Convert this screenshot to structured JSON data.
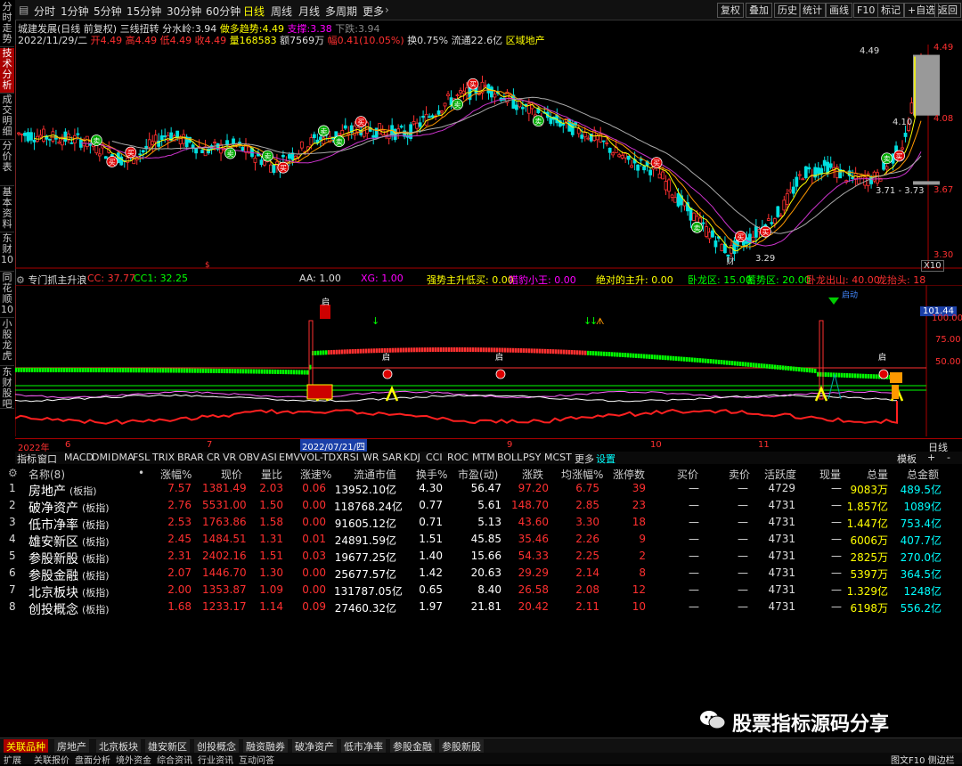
{
  "left_tabs": [
    {
      "label": "分时走势",
      "active": false
    },
    {
      "label": "技术分析",
      "active": true
    },
    {
      "label": "成交明细",
      "active": false
    },
    {
      "label": "分价表",
      "active": false
    },
    {
      "label": "基本资料",
      "active": false
    },
    {
      "label": "东财10",
      "active": false
    },
    {
      "label": "同花顺10",
      "active": false
    },
    {
      "label": "小股龙虎",
      "active": false
    },
    {
      "label": "东财股吧",
      "active": false
    }
  ],
  "periods": [
    "分时",
    "1分钟",
    "5分钟",
    "15分钟",
    "30分钟",
    "60分钟",
    "日线",
    "周线",
    "月线",
    "多周期",
    "更多"
  ],
  "active_period": "日线",
  "top_right_buttons": [
    "复权",
    "叠加",
    "历史",
    "统计",
    "画线",
    "F10",
    "标记",
    "+自选",
    "返回"
  ],
  "stock": {
    "title": "城建发展(日线 前复权)",
    "indicator": "三线扭转",
    "fenshuiling_label": "分水岭:",
    "fenshuiling": "3.94",
    "zuoduo_label": "做多趋势:",
    "zuoduo": "4.49",
    "zhicheng_label": "支撑:",
    "zhicheng": "3.38",
    "xiadie_label": "下跌:",
    "xiadie": "3.94",
    "date": "2022/11/29/二",
    "open_label": "开",
    "open": "4.49",
    "high_label": "高",
    "high": "4.49",
    "low_label": "低",
    "low": "4.49",
    "close_label": "收",
    "close": "4.49",
    "vol_label": "量",
    "vol": "168583",
    "amount_label": "额",
    "amount": "7569万",
    "change_label": "幅",
    "change": "0.41(10.05%)",
    "turnover_label": "换",
    "turnover": "0.75%",
    "float_label": "流通",
    "float": "22.6亿",
    "sector": "区域地产"
  },
  "price_axis": [
    "4.49",
    "4.08",
    "3.67",
    "3.30"
  ],
  "price_annotations": {
    "high": "4.49",
    "mid": "4.10",
    "range": "3.71 - 3.73",
    "low": "3.29",
    "x_label": "X10"
  },
  "lower_panel": {
    "title": "专门抓主升浪",
    "items": [
      {
        "label": "CC: 37.77",
        "color": "#ff3030"
      },
      {
        "label": "CC1: 32.25",
        "color": "#0f0"
      },
      {
        "label": "AA: 1.00",
        "color": "#ddd"
      },
      {
        "label": "XG: 1.00",
        "color": "#f0f"
      },
      {
        "label": "强势主升低买: 0.00",
        "color": "#ff0"
      },
      {
        "label": "猎豹小王: 0.00",
        "color": "#f0f"
      },
      {
        "label": "绝对的主升: 0.00",
        "color": "#ff0"
      },
      {
        "label": "卧龙区: 15.00",
        "color": "#0f0"
      },
      {
        "label": "蓄势区: 20.00",
        "color": "#0f0"
      },
      {
        "label": "卧龙出山: 40.00",
        "color": "#ff3030"
      },
      {
        "label": "龙抬头: 18",
        "color": "#ff3030"
      }
    ],
    "axis": [
      "101.44",
      "100.00",
      "75.00",
      "50.00"
    ],
    "marks": {
      "start": "启",
      "buy": "买入",
      "sell": "卖出",
      "qi_dong": "启动"
    }
  },
  "date_axis": {
    "labels": [
      "2022年",
      "6",
      "7",
      "2022/07/21/四",
      "9",
      "10",
      "11"
    ],
    "period": "日线"
  },
  "indicator_tabs": [
    "指标",
    "窗口",
    "MACD",
    "DMI",
    "DMA",
    "FSL",
    "TRIX",
    "BRAR",
    "CR",
    "VR",
    "OBV",
    "ASI",
    "EMV",
    "VOL-TDX",
    "RSI",
    "WR",
    "SAR",
    "KDJ",
    "CCI",
    "ROC",
    "MTM",
    "BOLL",
    "PSY",
    "MCST",
    "更多",
    "设置"
  ],
  "indicator_right": [
    "模板",
    "+",
    "-"
  ],
  "table": {
    "headers": [
      "名称(8)",
      "•",
      "涨幅%",
      "现价",
      "量比",
      "涨速%",
      "流通市值",
      "换手%",
      "市盈(动)",
      "涨跌",
      "均涨幅%",
      "涨停数",
      "买价",
      "卖价",
      "活跃度",
      "现量",
      "总量",
      "总金额"
    ],
    "rows": [
      {
        "idx": "1",
        "name": "房地产",
        "tag": "(板指)",
        "chg": "7.57",
        "price": "1381.49",
        "lb": "2.03",
        "speed": "0.06",
        "mv": "13952.10亿",
        "turn": "4.30",
        "pe": "56.47",
        "diff": "97.20",
        "avg": "6.75",
        "zt": "39",
        "buy": "—",
        "sell": "—",
        "act": "4729",
        "cur": "—",
        "vol": "9083万",
        "amt": "489.5亿"
      },
      {
        "idx": "2",
        "name": "破净资产",
        "tag": "(板指)",
        "chg": "2.76",
        "price": "5531.00",
        "lb": "1.50",
        "speed": "0.00",
        "mv": "118768.24亿",
        "turn": "0.77",
        "pe": "5.61",
        "diff": "148.70",
        "avg": "2.85",
        "zt": "23",
        "buy": "—",
        "sell": "—",
        "act": "4731",
        "cur": "—",
        "vol": "1.857亿",
        "amt": "1089亿"
      },
      {
        "idx": "3",
        "name": "低市净率",
        "tag": "(板指)",
        "chg": "2.53",
        "price": "1763.86",
        "lb": "1.58",
        "speed": "0.00",
        "mv": "91605.12亿",
        "turn": "0.71",
        "pe": "5.13",
        "diff": "43.60",
        "avg": "3.30",
        "zt": "18",
        "buy": "—",
        "sell": "—",
        "act": "4731",
        "cur": "—",
        "vol": "1.447亿",
        "amt": "753.4亿"
      },
      {
        "idx": "4",
        "name": "雄安新区",
        "tag": "(板指)",
        "chg": "2.45",
        "price": "1484.51",
        "lb": "1.31",
        "speed": "0.01",
        "mv": "24891.59亿",
        "turn": "1.51",
        "pe": "45.85",
        "diff": "35.46",
        "avg": "2.26",
        "zt": "9",
        "buy": "—",
        "sell": "—",
        "act": "4731",
        "cur": "—",
        "vol": "6006万",
        "amt": "407.7亿"
      },
      {
        "idx": "5",
        "name": "参股新股",
        "tag": "(板指)",
        "chg": "2.31",
        "price": "2402.16",
        "lb": "1.51",
        "speed": "0.03",
        "mv": "19677.25亿",
        "turn": "1.40",
        "pe": "15.66",
        "diff": "54.33",
        "avg": "2.25",
        "zt": "2",
        "buy": "—",
        "sell": "—",
        "act": "4731",
        "cur": "—",
        "vol": "2825万",
        "amt": "270.0亿"
      },
      {
        "idx": "6",
        "name": "参股金融",
        "tag": "(板指)",
        "chg": "2.07",
        "price": "1446.70",
        "lb": "1.30",
        "speed": "0.00",
        "mv": "25677.57亿",
        "turn": "1.42",
        "pe": "20.63",
        "diff": "29.29",
        "avg": "2.14",
        "zt": "8",
        "buy": "—",
        "sell": "—",
        "act": "4731",
        "cur": "—",
        "vol": "5397万",
        "amt": "364.5亿"
      },
      {
        "idx": "7",
        "name": "北京板块",
        "tag": "(板指)",
        "chg": "2.00",
        "price": "1353.87",
        "lb": "1.09",
        "speed": "0.00",
        "mv": "131787.05亿",
        "turn": "0.65",
        "pe": "8.40",
        "diff": "26.58",
        "avg": "2.08",
        "zt": "12",
        "buy": "—",
        "sell": "—",
        "act": "4731",
        "cur": "—",
        "vol": "1.329亿",
        "amt": "1248亿"
      },
      {
        "idx": "8",
        "name": "创投概念",
        "tag": "(板指)",
        "chg": "1.68",
        "price": "1233.17",
        "lb": "1.14",
        "speed": "0.09",
        "mv": "27460.32亿",
        "turn": "1.97",
        "pe": "21.81",
        "diff": "20.42",
        "avg": "2.11",
        "zt": "10",
        "buy": "—",
        "sell": "—",
        "act": "4731",
        "cur": "—",
        "vol": "6198万",
        "amt": "556.2亿"
      }
    ]
  },
  "watermark": "股票指标源码分享",
  "bottom_tabs": [
    "关联品种",
    "房地产",
    "北京板块",
    "雄安新区",
    "创投概念",
    "融资融券",
    "破净资产",
    "低市净率",
    "参股金融",
    "参股新股"
  ],
  "status_tabs": [
    "扩展",
    "关联报价",
    "盘面分析",
    "境外资金",
    "综合资讯",
    "行业资讯",
    "互动问答"
  ],
  "status_right": "图文F10 侧边栏",
  "colors": {
    "up": "#ff3030",
    "down": "#00e0e0",
    "ma": "#ff0",
    "bg": "#000"
  }
}
